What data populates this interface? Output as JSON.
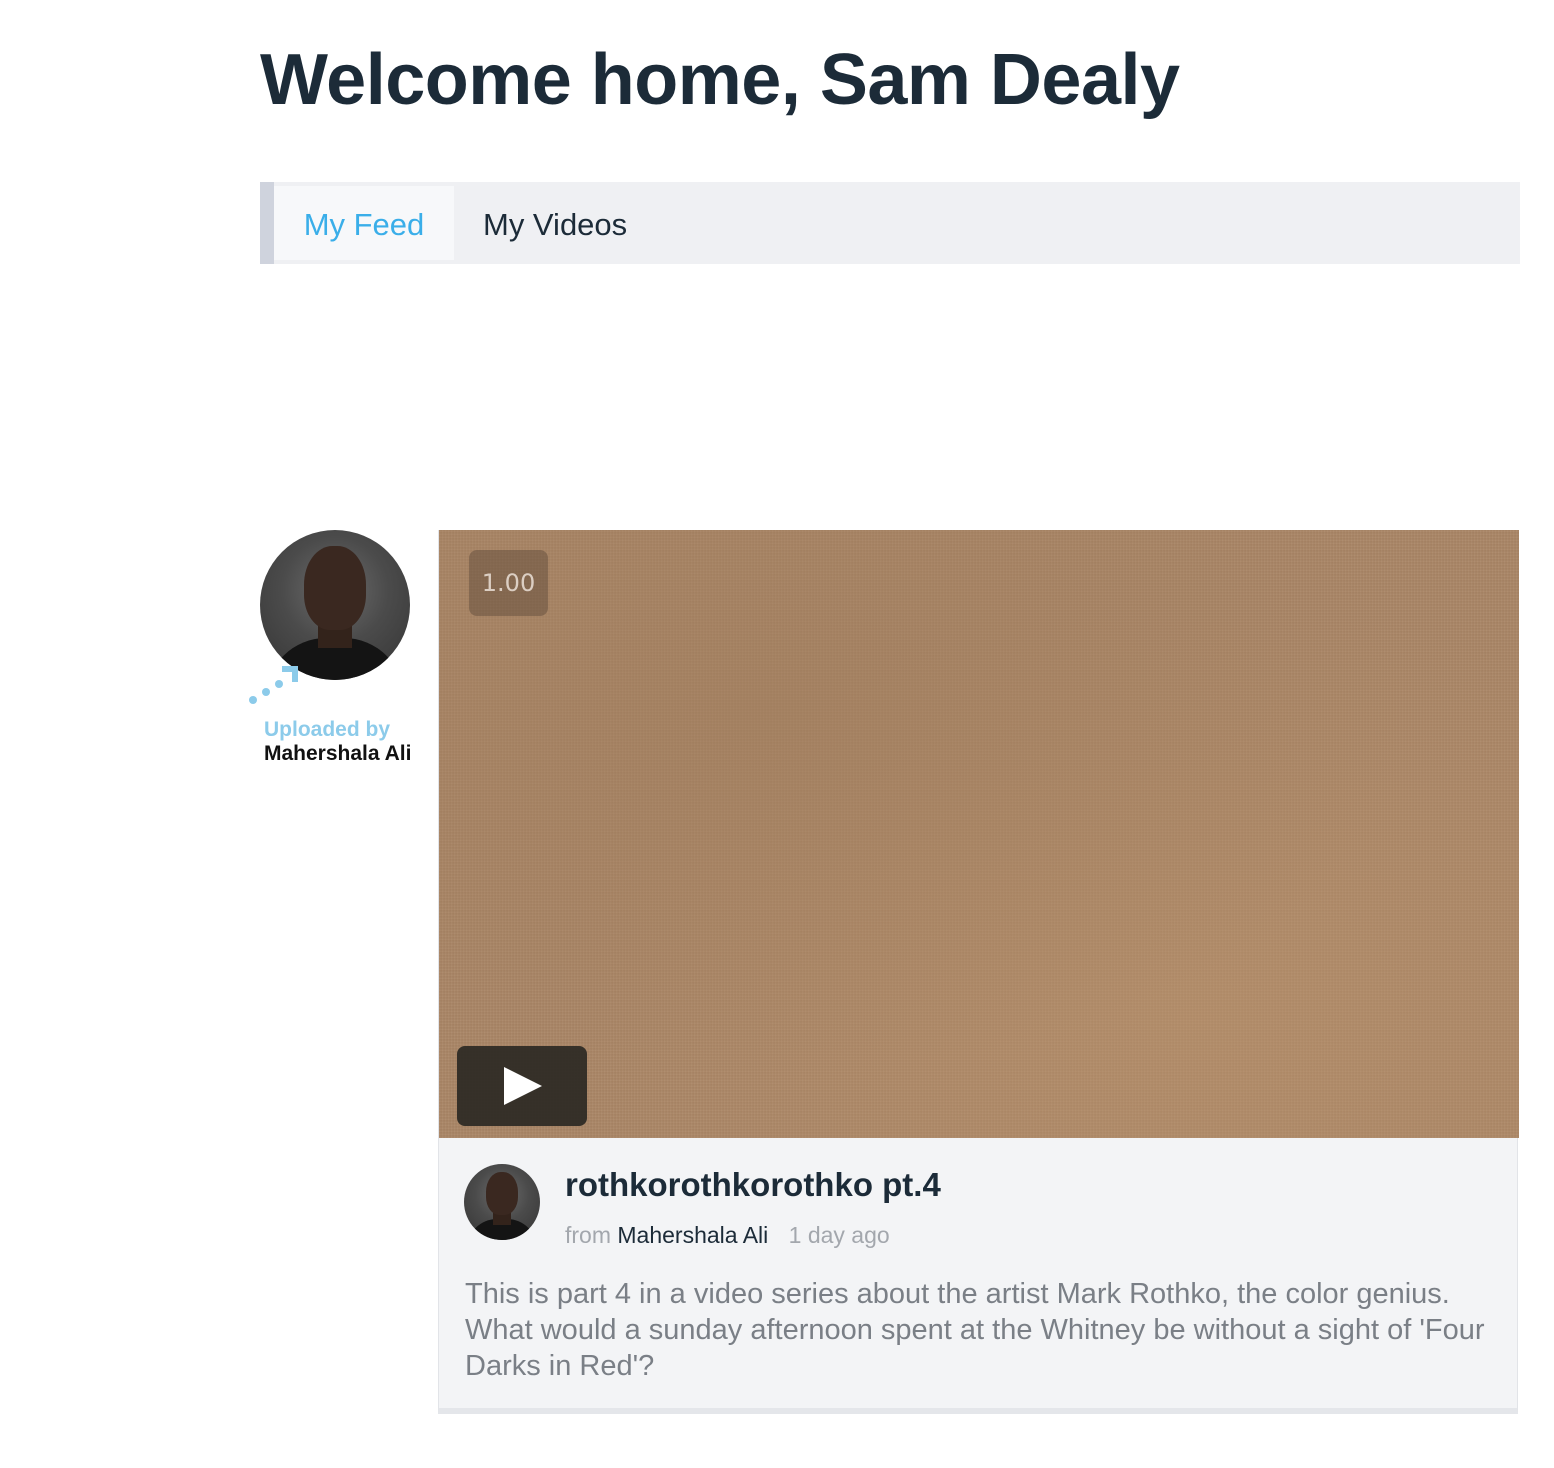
{
  "page": {
    "title": "Welcome home, Sam Dealy"
  },
  "tabs": [
    {
      "label": "My Feed",
      "active": true
    },
    {
      "label": "My Videos",
      "active": false
    }
  ],
  "colors": {
    "accent": "#3aaee9",
    "uploaded_label": "#8ccbea",
    "heading": "#1c2b38"
  },
  "uploader": {
    "label": "Uploaded by",
    "name": "Mahershala Ali",
    "icon": "upload-arrow-icon"
  },
  "video": {
    "playback_speed": "1.00",
    "title": "rothkorothkorothko pt.4",
    "from_label": "from",
    "author": "Mahershala Ali",
    "time_ago": "1 day ago",
    "description": "This is part 4 in a video series about the artist Mark Rothko, the color genius. What would a sunday afternoon spent at the Whitney be without a sight of 'Four Darks in Red'?",
    "play_icon": "play-icon"
  }
}
